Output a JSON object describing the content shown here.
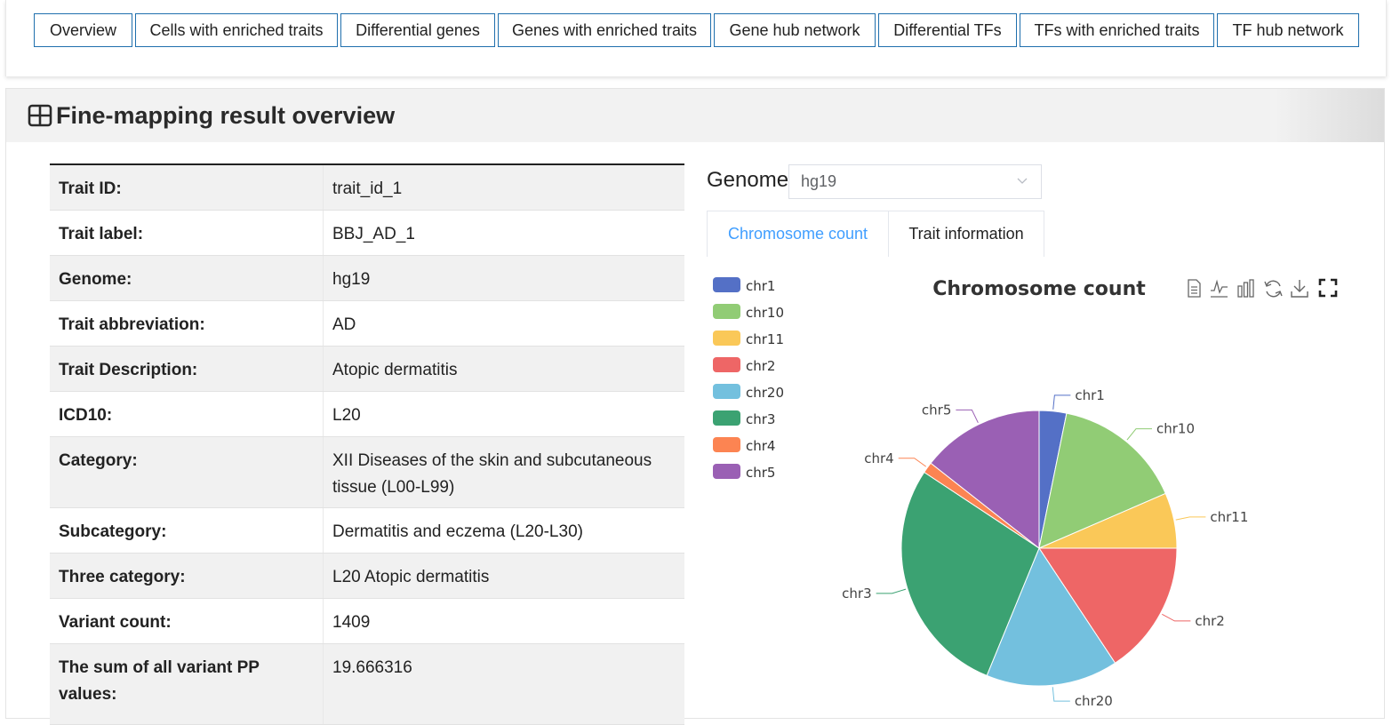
{
  "nav": {
    "tabs": [
      {
        "label": "Overview"
      },
      {
        "label": "Cells with enriched traits"
      },
      {
        "label": "Differential genes"
      },
      {
        "label": "Genes with enriched traits"
      },
      {
        "label": "Gene hub network"
      },
      {
        "label": "Differential TFs"
      },
      {
        "label": "TFs with enriched traits"
      },
      {
        "label": "TF hub network"
      }
    ]
  },
  "panel": {
    "title": "Fine-mapping result overview",
    "icon": "table-grid-icon"
  },
  "info_rows": [
    {
      "key": "Trait ID:",
      "value": "trait_id_1"
    },
    {
      "key": "Trait label:",
      "value": "BBJ_AD_1"
    },
    {
      "key": "Genome:",
      "value": "hg19"
    },
    {
      "key": "Trait abbreviation:",
      "value": "AD"
    },
    {
      "key": "Trait Description:",
      "value": "Atopic dermatitis"
    },
    {
      "key": "ICD10:",
      "value": "L20"
    },
    {
      "key": "Category:",
      "value": "XII Diseases of the skin and subcutaneous tissue (L00-L99)"
    },
    {
      "key": "Subcategory:",
      "value": "Dermatitis and eczema (L20-L30)"
    },
    {
      "key": "Three category:",
      "value": "L20 Atopic dermatitis"
    },
    {
      "key": "Variant count:",
      "value": "1409"
    },
    {
      "key": "The sum of all variant PP values:",
      "value": "19.666316"
    }
  ],
  "genome_selector": {
    "label": "Genome:",
    "value": "hg19"
  },
  "chart_tabs": {
    "active": "Chromosome count",
    "inactive": "Trait information"
  },
  "toolbox_icons": [
    "data-view-icon",
    "line-chart-icon",
    "bar-chart-icon",
    "restore-icon",
    "save-image-icon",
    "fullscreen-icon"
  ],
  "chart_data": {
    "type": "pie",
    "title": "Chromosome count",
    "legend_position": "left",
    "slices": [
      {
        "name": "chr1",
        "value": 3.2,
        "color": "#5470c6"
      },
      {
        "name": "chr10",
        "value": 15.3,
        "color": "#91cc75"
      },
      {
        "name": "chr11",
        "value": 6.5,
        "color": "#fac858"
      },
      {
        "name": "chr2",
        "value": 15.7,
        "color": "#ee6666"
      },
      {
        "name": "chr20",
        "value": 15.5,
        "color": "#73c0de"
      },
      {
        "name": "chr3",
        "value": 28.1,
        "color": "#3ba272"
      },
      {
        "name": "chr4",
        "value": 1.3,
        "color": "#fc8452"
      },
      {
        "name": "chr5",
        "value": 14.4,
        "color": "#9a60b4"
      }
    ]
  }
}
